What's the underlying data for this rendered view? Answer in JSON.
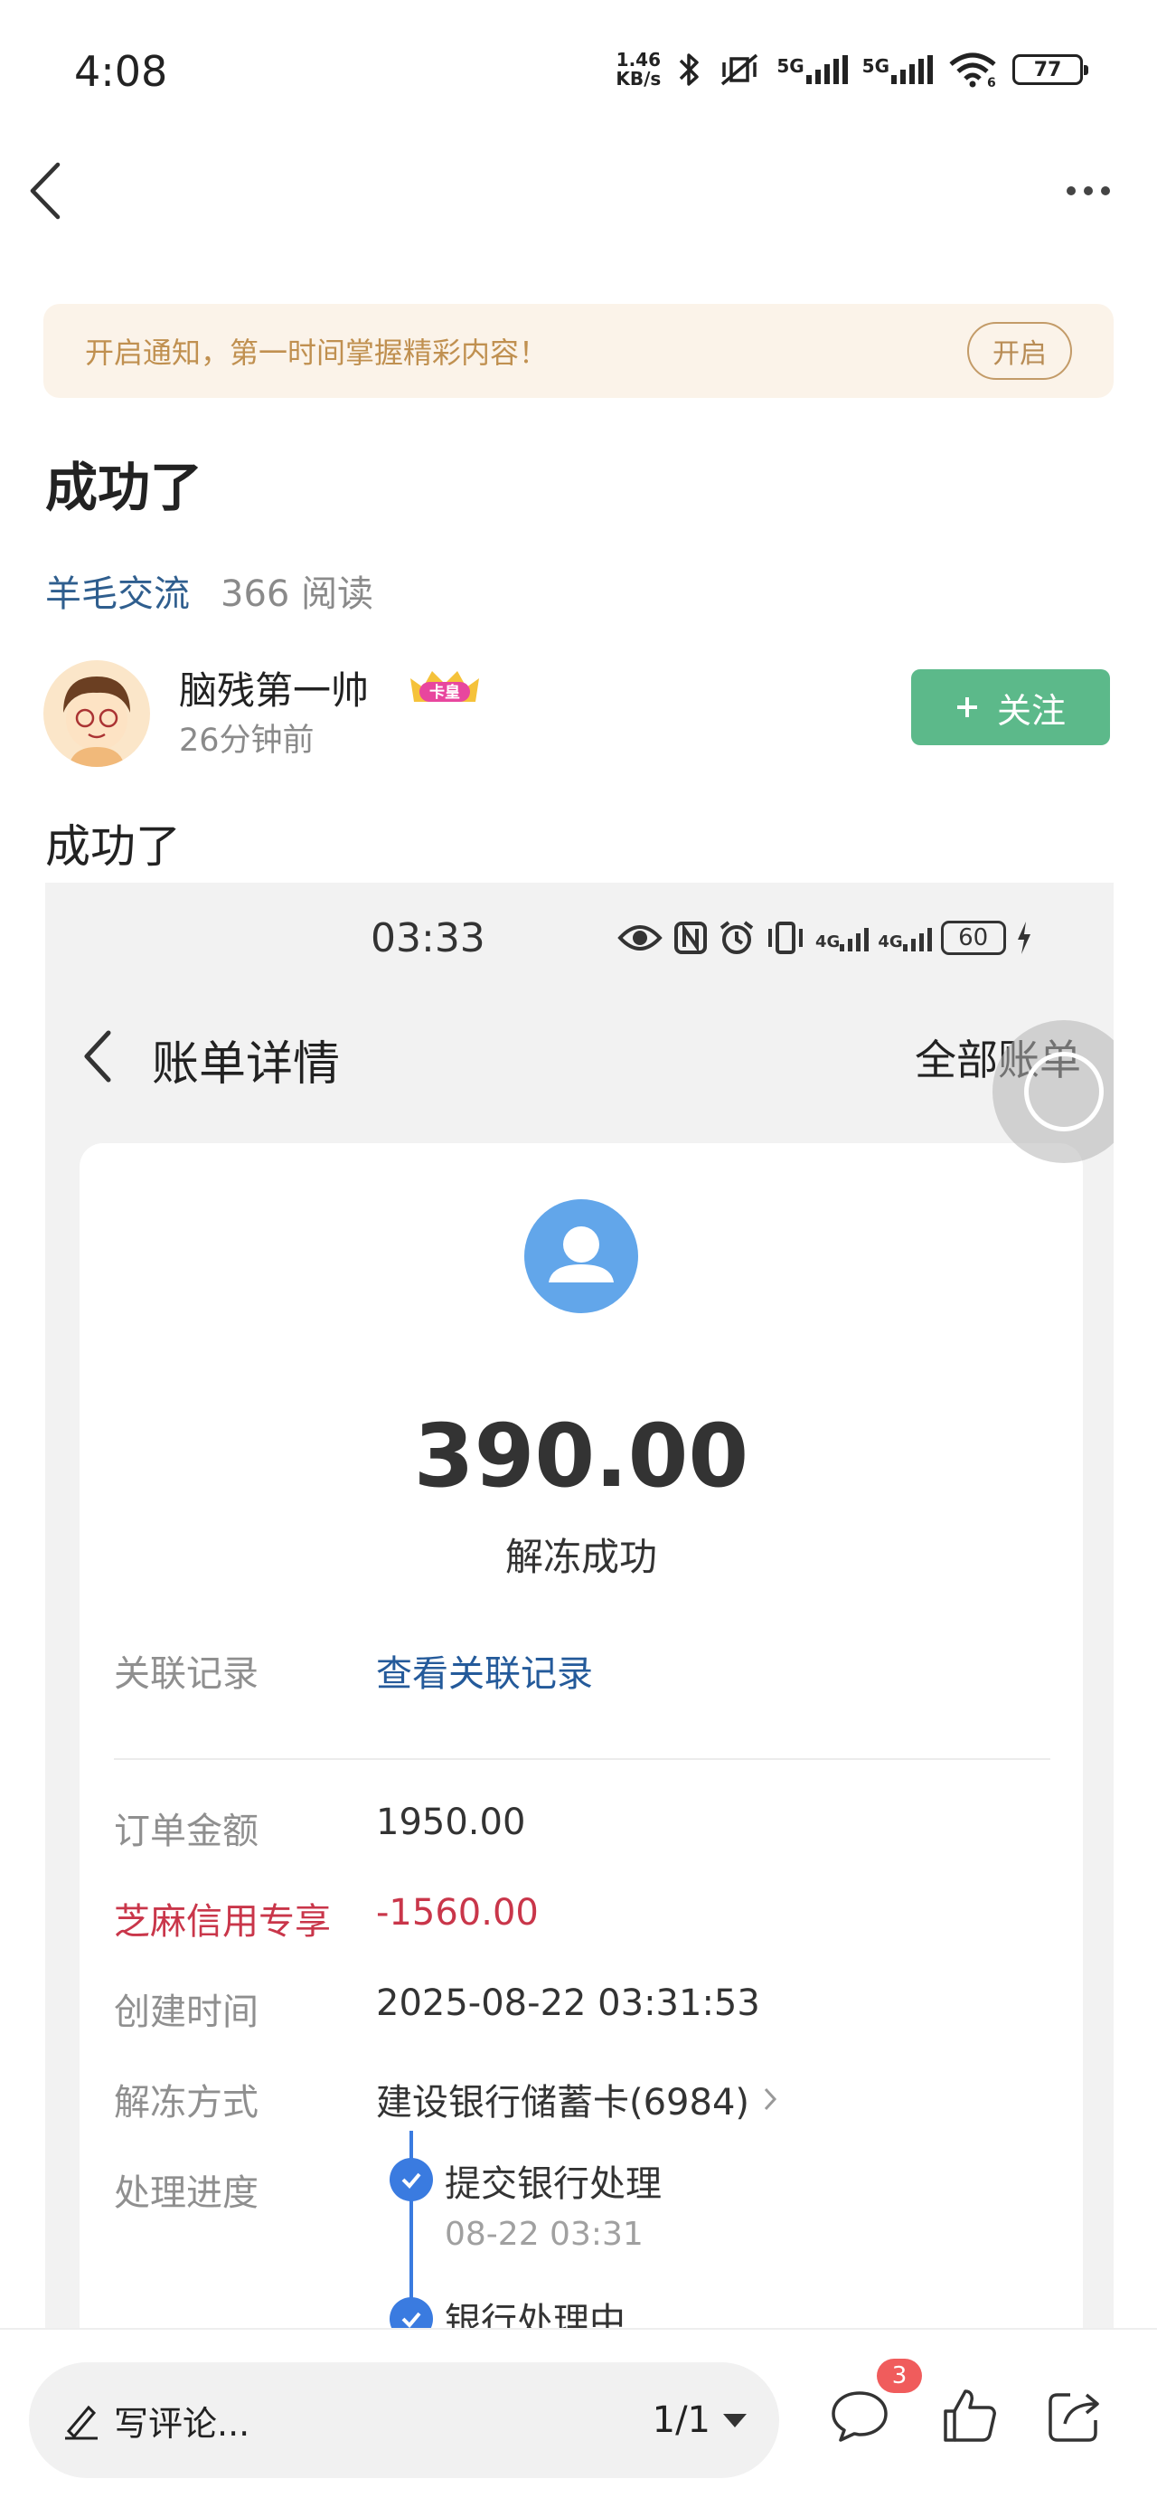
{
  "status_bar": {
    "time": "4:08",
    "net_speed_value": "1.46",
    "net_speed_unit": "KB/s",
    "sim1": "5G",
    "sim2": "5G",
    "wifi_label": "6",
    "battery": "77"
  },
  "notice": {
    "text": "开启通知，第一时间掌握精彩内容！",
    "button": "开启"
  },
  "post": {
    "title": "成功了",
    "category": "羊毛交流",
    "reads": "366 阅读",
    "body": "成功了"
  },
  "author": {
    "name": "脑残第一帅",
    "badge": "卡皇",
    "time": "26分钟前",
    "follow_label": "关注"
  },
  "screenshot": {
    "status_time": "03:33",
    "sig_label_1": "4G",
    "sig_label_2": "4G",
    "battery": "60",
    "title": "账单详情",
    "all_bills": "全部账单",
    "amount": "390.00",
    "status": "解冻成功",
    "rows": [
      {
        "label": "关联记录",
        "value": "查看关联记录"
      },
      {
        "label": "订单金额",
        "value": "1950.00"
      },
      {
        "label": "芝麻信用专享",
        "value": "-1560.00"
      },
      {
        "label": "创建时间",
        "value": "2025-08-22 03:31:53"
      },
      {
        "label": "解冻方式",
        "value": "建设银行储蓄卡(6984)"
      },
      {
        "label": "处理进度",
        "value": ""
      }
    ],
    "timeline": [
      {
        "title": "提交银行处理",
        "time": "08-22 03:31"
      },
      {
        "title": "银行处理中",
        "time": ""
      }
    ]
  },
  "bottom_bar": {
    "comment_placeholder": "写评论...",
    "pager": "1/1",
    "comment_count": "3"
  },
  "colors": {
    "accent_green": "#5cb98a",
    "link_blue": "#2f5e8e",
    "notice_bg": "#fbf3e9",
    "highlight_red": "#c9364a",
    "timeline_blue": "#3a7be0"
  }
}
